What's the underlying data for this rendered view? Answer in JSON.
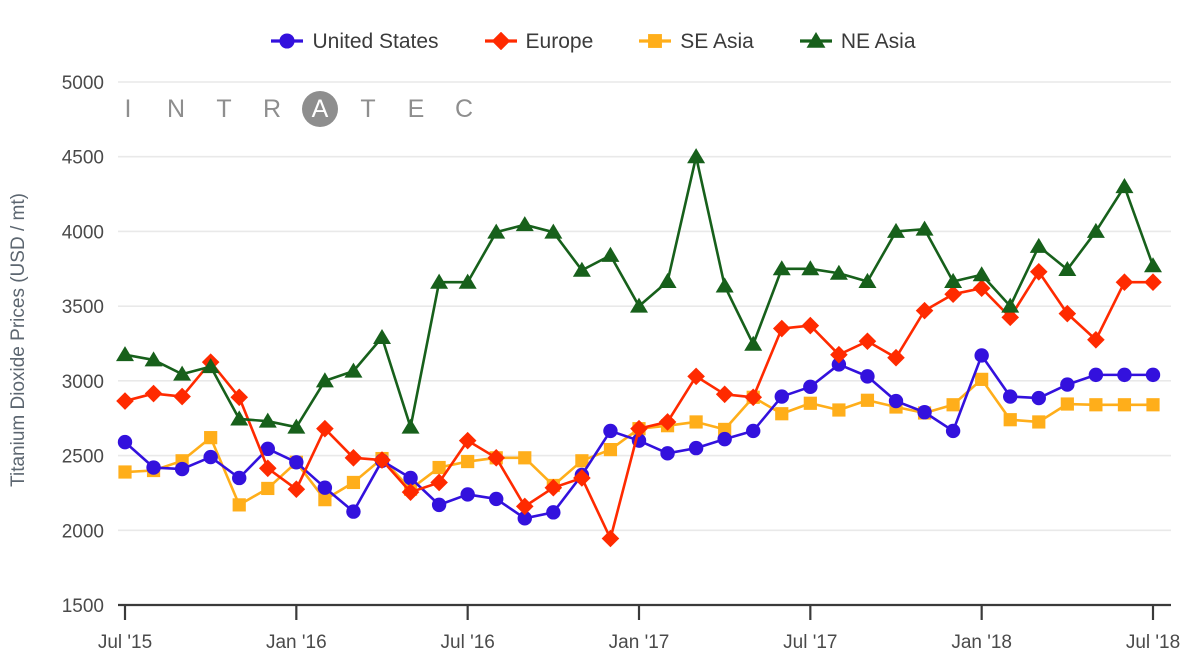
{
  "watermark": {
    "letters": [
      "I",
      "N",
      "T",
      "R"
    ],
    "circle_letter": "A",
    "letters_after": [
      "T",
      "E",
      "C"
    ],
    "color": "#8e8e8e"
  },
  "legend": {
    "position": "top-center",
    "items": [
      {
        "label": "United States",
        "color": "#3311DD",
        "marker": "circle"
      },
      {
        "label": "Europe",
        "color": "#FF2A00",
        "marker": "diamond"
      },
      {
        "label": "SE Asia",
        "color": "#FFAE1A",
        "marker": "square"
      },
      {
        "label": "NE Asia",
        "color": "#17601B",
        "marker": "triangle"
      }
    ]
  },
  "chart_data": {
    "type": "line",
    "title": "",
    "subtitle": "",
    "xlabel": "",
    "ylabel": "Titanium Dioxide Prices (USD / mt)",
    "ylim": [
      1500,
      5000
    ],
    "ytick_labels": [
      "5000",
      "4500",
      "4000",
      "3500",
      "3000",
      "2500",
      "2000",
      "1500"
    ],
    "yticks": [
      5000,
      4500,
      4000,
      3500,
      3000,
      2500,
      2000,
      1500
    ],
    "xtick_labels": [
      "Jul '15",
      "Jan '16",
      "Jul '16",
      "Jan '17",
      "Jul '17",
      "Jan '18",
      "Jul '18"
    ],
    "xticks": [
      "2015-07",
      "2016-01",
      "2016-07",
      "2017-01",
      "2017-07",
      "2018-01",
      "2018-07"
    ],
    "grid": true,
    "legend_position": "top",
    "x": [
      "2015-07",
      "2015-08",
      "2015-09",
      "2015-10",
      "2015-11",
      "2015-12",
      "2016-01",
      "2016-02",
      "2016-03",
      "2016-04",
      "2016-05",
      "2016-06",
      "2016-07",
      "2016-08",
      "2016-09",
      "2016-10",
      "2016-11",
      "2016-12",
      "2017-01",
      "2017-02",
      "2017-03",
      "2017-04",
      "2017-05",
      "2017-06",
      "2017-07",
      "2017-08",
      "2017-09",
      "2017-10",
      "2017-11",
      "2017-12",
      "2018-01",
      "2018-02",
      "2018-03",
      "2018-04",
      "2018-05",
      "2018-06",
      "2018-07"
    ],
    "series": [
      {
        "name": "United States",
        "color": "#3311DD",
        "marker": "circle",
        "values": [
          2590,
          2420,
          2410,
          2490,
          2350,
          2545,
          2455,
          2285,
          2125,
          2465,
          2350,
          2170,
          2240,
          2210,
          2080,
          2120,
          2370,
          2665,
          2600,
          2515,
          2550,
          2610,
          2665,
          2895,
          2960,
          3110,
          3030,
          2865,
          2790,
          2665,
          3170,
          2895,
          2885,
          2975,
          3040,
          3040,
          3040
        ]
      },
      {
        "name": "Europe",
        "color": "#FF2A00",
        "marker": "diamond",
        "values": [
          2865,
          2915,
          2895,
          3125,
          2890,
          2415,
          2275,
          2680,
          2485,
          2470,
          2255,
          2320,
          2600,
          2485,
          2160,
          2285,
          2350,
          1945,
          2680,
          2725,
          3030,
          2910,
          2890,
          3350,
          3370,
          3175,
          3265,
          3155,
          3470,
          3580,
          3620,
          3425,
          3730,
          3450,
          3275,
          3660,
          3660
        ]
      },
      {
        "name": "SE Asia",
        "color": "#FFAE1A",
        "marker": "square",
        "values": [
          2390,
          2400,
          2465,
          2620,
          2170,
          2280,
          2455,
          2205,
          2320,
          2480,
          2275,
          2420,
          2460,
          2485,
          2485,
          2300,
          2465,
          2540,
          2680,
          2700,
          2725,
          2675,
          2890,
          2780,
          2850,
          2805,
          2870,
          2825,
          2785,
          2840,
          3010,
          2740,
          2725,
          2845,
          2840,
          2840,
          2840
        ]
      },
      {
        "name": "NE Asia",
        "color": "#17601B",
        "marker": "triangle",
        "values": [
          3175,
          3140,
          3045,
          3095,
          2745,
          2730,
          2690,
          3000,
          3065,
          3290,
          2690,
          3660,
          3660,
          3995,
          4045,
          3995,
          3740,
          3840,
          3500,
          3665,
          4500,
          3635,
          3245,
          3750,
          3750,
          3720,
          3665,
          4000,
          4015,
          3665,
          3710,
          3500,
          3900,
          3745,
          4000,
          4300,
          3770
        ]
      }
    ]
  }
}
